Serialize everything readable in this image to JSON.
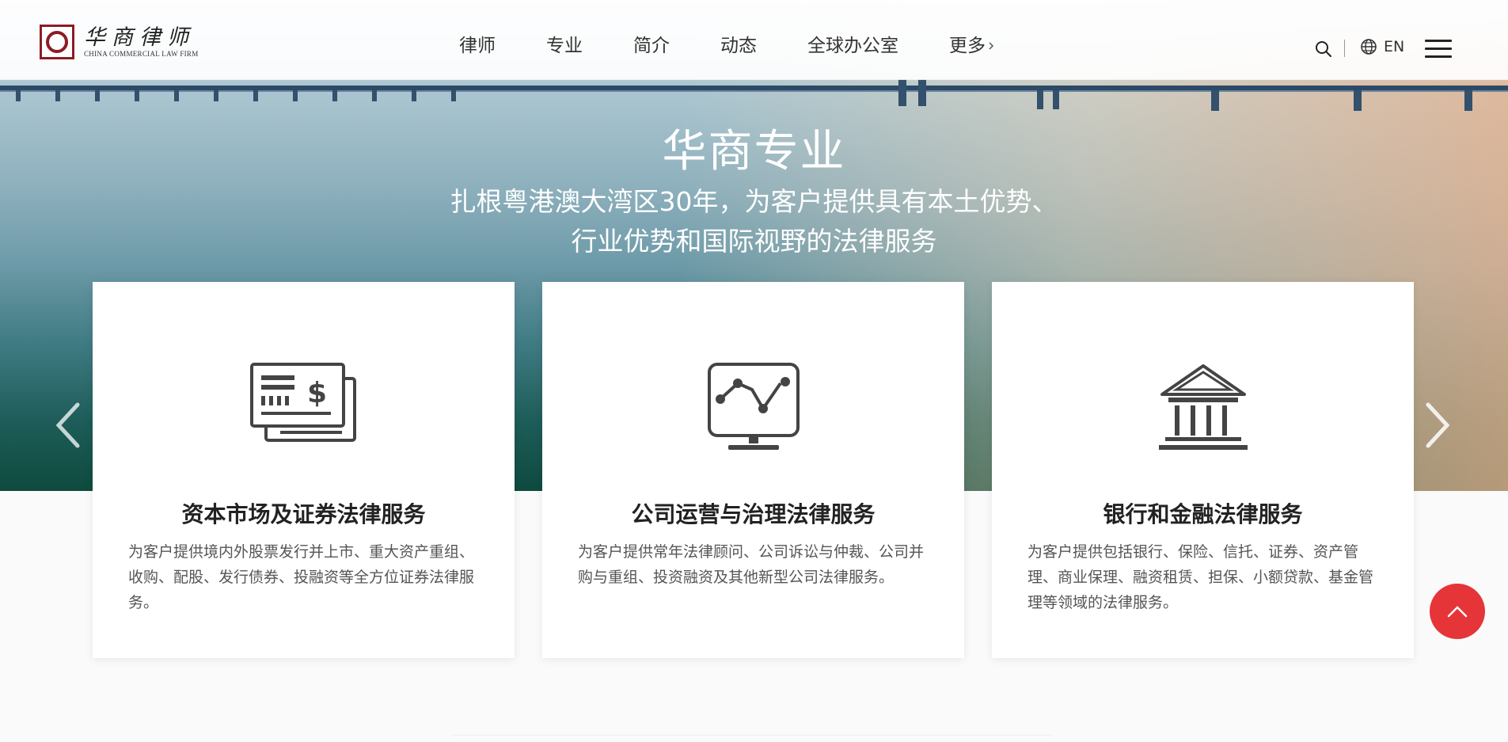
{
  "brand": {
    "name_cn": "华商律师",
    "name_en": "CHINA COMMERCIAL LAW FIRM",
    "color": "#8c1c24"
  },
  "nav": {
    "items": [
      {
        "label": "律师"
      },
      {
        "label": "专业"
      },
      {
        "label": "简介"
      },
      {
        "label": "动态"
      },
      {
        "label": "全球办公室"
      },
      {
        "label": "更多"
      }
    ],
    "lang_label": "EN",
    "icons": {
      "search": "search-icon",
      "globe": "globe-icon",
      "menu": "menu-icon",
      "more": "chevron-right-icon"
    }
  },
  "hero": {
    "title": "华商专业",
    "subtitle_line1": "扎根粤港澳大湾区30年，为客户提供具有本土优势、",
    "subtitle_line2": "行业优势和国际视野的法律服务"
  },
  "cards": [
    {
      "title": "资本市场及证券法律服务",
      "desc": "为客户提供境内外股票发行并上市、重大资产重组、收购、配股、发行债券、投融资等全方位证券法律服务。",
      "icon": "securities-icon"
    },
    {
      "title": "公司运营与治理法律服务",
      "desc": "为客户提供常年法律顾问、公司诉讼与仲裁、公司并购与重组、投资融资及其他新型公司法律服务。",
      "icon": "chart-monitor-icon"
    },
    {
      "title": "银行和金融法律服务",
      "desc": "为客户提供包括银行、保险、信托、证券、资产管理、商业保理、融资租赁、担保、小额贷款、基金管理等领域的法律服务。",
      "icon": "bank-icon"
    }
  ],
  "colors": {
    "accent": "#e53539",
    "text": "#333333"
  }
}
